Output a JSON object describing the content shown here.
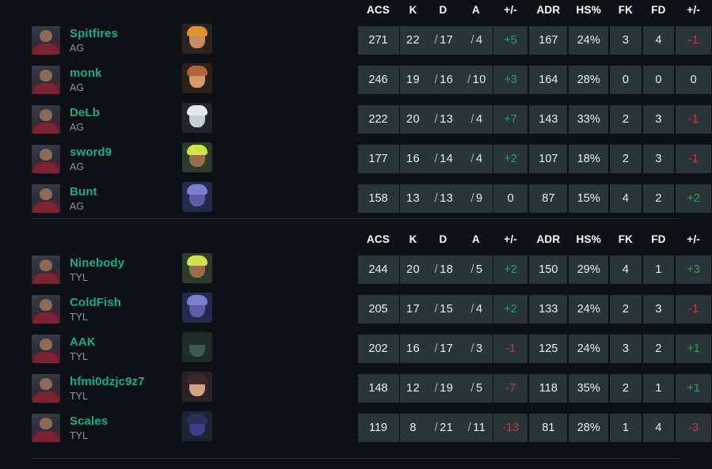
{
  "columns": [
    {
      "key": "player",
      "label": ""
    },
    {
      "key": "agent",
      "label": ""
    },
    {
      "key": "acs",
      "label": "ACS"
    },
    {
      "key": "k",
      "label": "K"
    },
    {
      "key": "d",
      "label": "D"
    },
    {
      "key": "a",
      "label": "A"
    },
    {
      "key": "pm1",
      "label": "+/-"
    },
    {
      "key": "adr",
      "label": "ADR"
    },
    {
      "key": "hs",
      "label": "HS%"
    },
    {
      "key": "fk",
      "label": "FK"
    },
    {
      "key": "fd",
      "label": "FD"
    },
    {
      "key": "pm2",
      "label": "+/-"
    }
  ],
  "colors": {
    "background": "#0d1116",
    "cell": "#2a3537",
    "player_name": "#1aab8c",
    "team_tag": "#8d979e",
    "positive": "#2e9e74",
    "negative": "#c23a4b",
    "neutral": "#e9eef2",
    "header_text": "#ffffff",
    "divider": "#262c33"
  },
  "teams": [
    {
      "id": "team-ag",
      "tag": "AG",
      "header": {
        "acs": "ACS",
        "k": "K",
        "d": "D",
        "a": "A",
        "pm1": "+/-",
        "adr": "ADR",
        "hs": "HS%",
        "fk": "FK",
        "fd": "FD",
        "pm2": "+/-"
      },
      "players": [
        {
          "name": "Spitfires",
          "team": "AG",
          "agent_icon": "agent-portrait-skye",
          "agent_colors": {
            "bg": "#2b2320",
            "face": "#c98b63",
            "hair": "#e0922f"
          },
          "acs": "271",
          "k": "22",
          "d": "17",
          "a": "4",
          "pm1": "+5",
          "pm1_sign": "pos",
          "adr": "167",
          "hs": "24%",
          "fk": "3",
          "fd": "4",
          "pm2": "-1",
          "pm2_sign": "neg"
        },
        {
          "name": "monk",
          "team": "AG",
          "agent_icon": "agent-portrait-breach",
          "agent_colors": {
            "bg": "#2a211c",
            "face": "#d79a6c",
            "hair": "#b4603a"
          },
          "acs": "246",
          "k": "19",
          "d": "16",
          "a": "10",
          "pm1": "+3",
          "pm1_sign": "pos",
          "adr": "164",
          "hs": "28%",
          "fk": "0",
          "fd": "0",
          "pm2": "0",
          "pm2_sign": "zero"
        },
        {
          "name": "DeLb",
          "team": "AG",
          "agent_icon": "agent-portrait-cypher",
          "agent_colors": {
            "bg": "#23252a",
            "face": "#c9cdd4",
            "hair": "#e4e7ec"
          },
          "acs": "222",
          "k": "20",
          "d": "13",
          "a": "4",
          "pm1": "+7",
          "pm1_sign": "pos",
          "adr": "143",
          "hs": "33%",
          "fk": "2",
          "fd": "3",
          "pm2": "-1",
          "pm2_sign": "neg"
        },
        {
          "name": "sword9",
          "team": "AG",
          "agent_icon": "agent-portrait-phoenix",
          "agent_colors": {
            "bg": "#2e3a2a",
            "face": "#9b6b48",
            "hair": "#cfe34a"
          },
          "acs": "177",
          "k": "16",
          "d": "14",
          "a": "4",
          "pm1": "+2",
          "pm1_sign": "pos",
          "adr": "107",
          "hs": "18%",
          "fk": "2",
          "fd": "3",
          "pm2": "-1",
          "pm2_sign": "neg"
        },
        {
          "name": "Bunt",
          "team": "AG",
          "agent_icon": "agent-portrait-omen",
          "agent_colors": {
            "bg": "#262a4a",
            "face": "#5b5fa8",
            "hair": "#7b7fd4"
          },
          "acs": "158",
          "k": "13",
          "d": "13",
          "a": "9",
          "pm1": "0",
          "pm1_sign": "zero",
          "adr": "87",
          "hs": "15%",
          "fk": "4",
          "fd": "2",
          "pm2": "+2",
          "pm2_sign": "pos"
        }
      ]
    },
    {
      "id": "team-tyl",
      "tag": "TYL",
      "header": {
        "acs": "ACS",
        "k": "K",
        "d": "D",
        "a": "A",
        "pm1": "+/-",
        "adr": "ADR",
        "hs": "HS%",
        "fk": "FK",
        "fd": "FD",
        "pm2": "+/-"
      },
      "players": [
        {
          "name": "Ninebody",
          "team": "TYL",
          "agent_icon": "agent-portrait-phoenix",
          "agent_colors": {
            "bg": "#2e3a2a",
            "face": "#9b6b48",
            "hair": "#cfe34a"
          },
          "acs": "244",
          "k": "20",
          "d": "18",
          "a": "5",
          "pm1": "+2",
          "pm1_sign": "pos",
          "adr": "150",
          "hs": "29%",
          "fk": "4",
          "fd": "1",
          "pm2": "+3",
          "pm2_sign": "pos"
        },
        {
          "name": "ColdFish",
          "team": "TYL",
          "agent_icon": "agent-portrait-omen",
          "agent_colors": {
            "bg": "#262a4a",
            "face": "#5b5fa8",
            "hair": "#7b7fd4"
          },
          "acs": "205",
          "k": "17",
          "d": "15",
          "a": "4",
          "pm1": "+2",
          "pm1_sign": "pos",
          "adr": "133",
          "hs": "24%",
          "fk": "2",
          "fd": "3",
          "pm2": "-1",
          "pm2_sign": "neg"
        },
        {
          "name": "AAK",
          "team": "TYL",
          "agent_icon": "agent-portrait-viper",
          "agent_colors": {
            "bg": "#1f2a2b",
            "face": "#3f5a52",
            "hair": "#1e2c2e"
          },
          "acs": "202",
          "k": "16",
          "d": "17",
          "a": "3",
          "pm1": "-1",
          "pm1_sign": "neg",
          "adr": "125",
          "hs": "24%",
          "fk": "3",
          "fd": "2",
          "pm2": "+1",
          "pm2_sign": "pos"
        },
        {
          "name": "hfmi0dzjc9z7",
          "team": "TYL",
          "agent_icon": "agent-portrait-reyna",
          "agent_colors": {
            "bg": "#2a2228",
            "face": "#d1a083",
            "hair": "#3b2a2e"
          },
          "acs": "148",
          "k": "12",
          "d": "19",
          "a": "5",
          "pm1": "-7",
          "pm1_sign": "neg",
          "adr": "118",
          "hs": "35%",
          "fk": "2",
          "fd": "1",
          "pm2": "+1",
          "pm2_sign": "pos"
        },
        {
          "name": "Scales",
          "team": "TYL",
          "agent_icon": "agent-portrait-fade",
          "agent_colors": {
            "bg": "#1e2433",
            "face": "#3b3f8a",
            "hair": "#2a2f55"
          },
          "acs": "119",
          "k": "8",
          "d": "21",
          "a": "11",
          "pm1": "-13",
          "pm1_sign": "neg",
          "adr": "81",
          "hs": "28%",
          "fk": "1",
          "fd": "4",
          "pm2": "-3",
          "pm2_sign": "neg"
        }
      ]
    }
  ]
}
